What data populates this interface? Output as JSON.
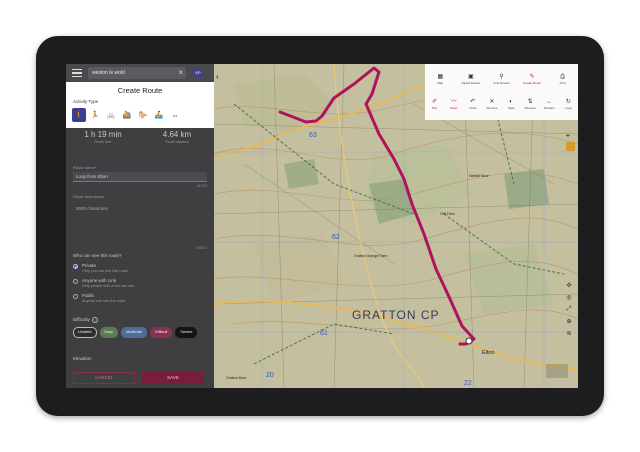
{
  "search": {
    "value": "weston le wold"
  },
  "avatar_initials": "KP",
  "create_route": {
    "title": "Create Route",
    "activity_label": "Activity Type",
    "activities": [
      {
        "name": "walk",
        "glyph": "🚶",
        "selected": true
      },
      {
        "name": "run",
        "glyph": "🏃",
        "selected": false
      },
      {
        "name": "cycle",
        "glyph": "🚲",
        "selected": false
      },
      {
        "name": "mountain-bike",
        "glyph": "🚵",
        "selected": false
      },
      {
        "name": "horse-ride",
        "glyph": "🐎",
        "selected": false
      },
      {
        "name": "paddle",
        "glyph": "🚣",
        "selected": false
      },
      {
        "name": "other",
        "glyph": "•••",
        "selected": false
      }
    ]
  },
  "stats": {
    "time_value": "1 h 19 min",
    "time_label": "Route time",
    "distance_value": "4.64 km",
    "distance_label": "Route distance"
  },
  "form": {
    "name_label": "Route name*",
    "name_value": "Loop from Elton",
    "name_counter": "15/100",
    "desc_label": "Route description",
    "desc_placeholder": "5000 characters",
    "desc_counter": "0/5000",
    "visibility_question": "Who can see this route?",
    "visibility": [
      {
        "title": "Private",
        "sub": "Only you can see this route",
        "selected": true
      },
      {
        "title": "Anyone with Link",
        "sub": "Only people with a link can see",
        "selected": false
      },
      {
        "title": "Public",
        "sub": "Anyone can see the route",
        "selected": false
      }
    ],
    "difficulty_label": "Difficulty",
    "difficulty": [
      {
        "label": "Unrated",
        "color": "#2e2e30",
        "border": "#bdbdbd"
      },
      {
        "label": "Easy",
        "color": "#5b7a55",
        "border": "#5b7a55"
      },
      {
        "label": "Moderate",
        "color": "#4b6f9a",
        "border": "#4b6f9a"
      },
      {
        "label": "Difficult",
        "color": "#8a3050",
        "border": "#8a3050"
      },
      {
        "label": "Severe",
        "color": "#141414",
        "border": "#141414"
      }
    ],
    "elevation_label": "Elevation",
    "cancel": "CANCEL",
    "save": "SAVE"
  },
  "toolbar": {
    "row1": [
      {
        "name": "map",
        "label": "Map",
        "glyph": "▦"
      },
      {
        "name": "saved-routes",
        "label": "Saved Routes",
        "glyph": "▣"
      },
      {
        "name": "find-routes",
        "label": "Find Routes",
        "glyph": "⚲"
      },
      {
        "name": "create-route",
        "label": "Create Route",
        "glyph": "✎"
      },
      {
        "name": "print",
        "label": "Print",
        "glyph": "⎙"
      }
    ],
    "row2": [
      {
        "name": "pen",
        "label": "Pen",
        "glyph": "✐"
      },
      {
        "name": "draw",
        "label": "Draw",
        "glyph": "〰"
      },
      {
        "name": "undo",
        "label": "Undo",
        "glyph": "↶"
      },
      {
        "name": "remove",
        "label": "Remove",
        "glyph": "✕"
      },
      {
        "name": "style",
        "label": "Style",
        "glyph": "◐"
      },
      {
        "name": "reverse",
        "label": "Reverse",
        "glyph": "⇅"
      },
      {
        "name": "retrace",
        "label": "Retrace",
        "glyph": "←"
      },
      {
        "name": "loop",
        "label": "Loop",
        "glyph": "↻"
      }
    ]
  },
  "map": {
    "labels": {
      "area": "GRATTON CP",
      "grid_63": "63",
      "grid_62": "62",
      "grid_61": "61",
      "grid_20": "20",
      "grid_22": "22",
      "elton": "Elton",
      "gratton": "Gratton Moor",
      "harthill": "Harthill Moor",
      "cliff": "Cliff Farm",
      "greengs": "Gratton Grange Farm"
    },
    "route_color": "#b0125e"
  }
}
